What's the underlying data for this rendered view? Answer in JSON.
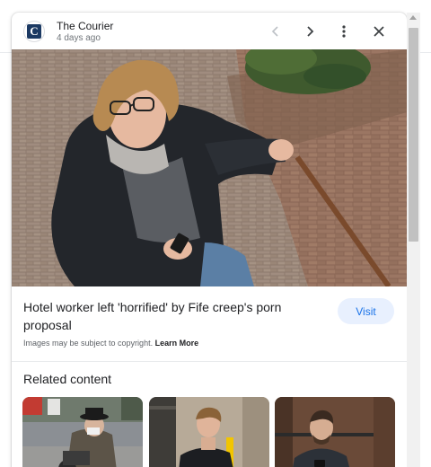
{
  "header": {
    "source_logo_letter": "C",
    "source_name": "The Courier",
    "timestamp": "4 days ago",
    "icons": [
      "chevron-left-icon",
      "chevron-right-icon",
      "more-vert-icon",
      "close-icon"
    ]
  },
  "article": {
    "title": "Hotel worker left 'horrified' by Fife creep's porn proposal",
    "visit_label": "Visit",
    "copyright_text": "Images may be subject to copyright.",
    "learn_more_label": "Learn More"
  },
  "related": {
    "heading": "Related content"
  },
  "colors": {
    "accent": "#1a73e8",
    "visit_bg": "#e8f0fe",
    "logo_bg": "#1c3a63"
  }
}
